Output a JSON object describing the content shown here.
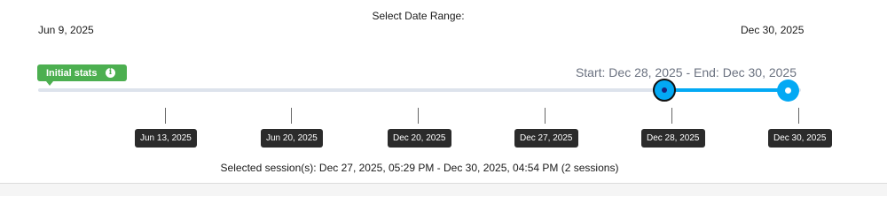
{
  "header": {
    "title": "Select Date Range:",
    "range_start": "Jun 9, 2025",
    "range_end": "Dec 30, 2025"
  },
  "badge": {
    "label": "Initial stats",
    "icon": "info-icon",
    "icon_glyph": "i",
    "color": "#4caf50"
  },
  "selection": {
    "label": "Start: Dec 28, 2025 - End: Dec 30, 2025",
    "start": "Dec 28, 2025",
    "end": "Dec 30, 2025"
  },
  "slider": {
    "accent_color": "#03a9f4",
    "track_color": "#dde3ec"
  },
  "ticks": [
    {
      "label": "Jun 13, 2025"
    },
    {
      "label": "Jun 20, 2025"
    },
    {
      "label": "Dec 20, 2025"
    },
    {
      "label": "Dec 27, 2025"
    },
    {
      "label": "Dec 28, 2025"
    },
    {
      "label": "Dec 30, 2025"
    }
  ],
  "footer": {
    "sessions_text": "Selected session(s): Dec 27, 2025, 05:29 PM - Dec 30, 2025, 04:54 PM (2 sessions)"
  }
}
